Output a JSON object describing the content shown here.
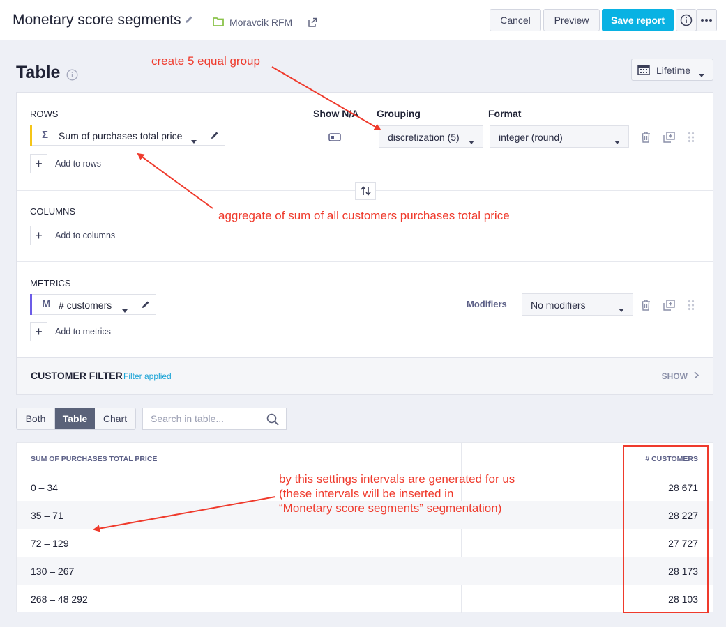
{
  "topbar": {
    "title": "Monetary score segments",
    "project": "Moravcik RFM",
    "cancel": "Cancel",
    "preview": "Preview",
    "save": "Save report"
  },
  "page": {
    "title": "Table",
    "period": "Lifetime"
  },
  "rows_section": {
    "label": "ROWS",
    "headers": {
      "show_na": "Show N/A",
      "grouping": "Grouping",
      "format": "Format"
    },
    "chip": {
      "symbol": "Σ",
      "label": "Sum of purchases total price"
    },
    "grouping_value": "discretization (5)",
    "format_value": "integer (round)",
    "add_label": "Add to rows"
  },
  "columns_section": {
    "label": "COLUMNS",
    "add_label": "Add to columns"
  },
  "metrics_section": {
    "label": "METRICS",
    "chip": {
      "symbol": "M",
      "label": "# customers"
    },
    "modifiers_label": "Modifiers",
    "modifiers_value": "No modifiers",
    "add_label": "Add to metrics"
  },
  "customer_filter": {
    "title": "CUSTOMER FILTER",
    "status": "Filter applied",
    "show": "SHOW"
  },
  "view_toggle": {
    "both": "Both",
    "table": "Table",
    "chart": "Chart",
    "active": "Table"
  },
  "search": {
    "placeholder": "Search in table..."
  },
  "result_table": {
    "headers": [
      "SUM OF PURCHASES TOTAL PRICE",
      "# CUSTOMERS"
    ],
    "rows": [
      [
        "0 – 34",
        "28 671"
      ],
      [
        "35 – 71",
        "28 227"
      ],
      [
        "72 – 129",
        "27 727"
      ],
      [
        "130 – 267",
        "28 173"
      ],
      [
        "268 – 48 292",
        "28 103"
      ]
    ]
  },
  "annotations": {
    "grouping_note": "create 5 equal group",
    "rows_note": "aggregate of sum of all customers purchases total price",
    "intervals_note_1": "by this settings intervals are generated for us",
    "intervals_note_2": "(these intervals will be inserted in",
    "intervals_note_3": "“Monetary score segments” segmentation)",
    "color": "#ef3a2c"
  },
  "colors": {
    "accent": "#09b2e3",
    "rows_bar": "#f5c518",
    "metrics_bar": "#6c5ce7",
    "active_toggle": "#5a6279",
    "project_icon": "#8bc34a"
  },
  "icons": [
    "pencil-icon",
    "folder-icon",
    "export-icon",
    "info-icon",
    "more-icon",
    "calendar-icon",
    "chevron-down-icon",
    "toggle-na-icon",
    "trash-icon",
    "duplicate-icon",
    "drag-handle-icon",
    "swap-icon",
    "search-icon",
    "chevron-right-icon"
  ]
}
